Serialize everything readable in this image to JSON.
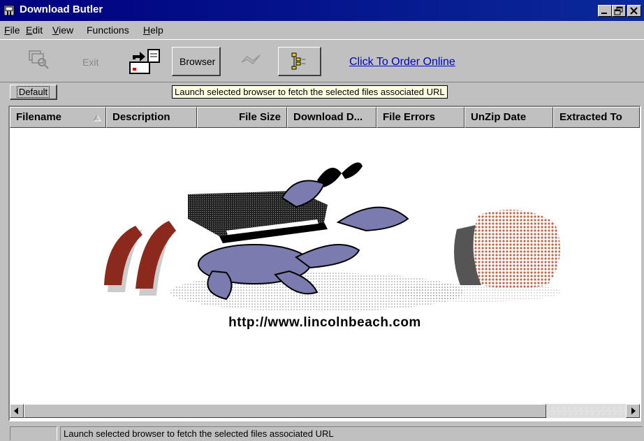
{
  "window": {
    "title": "Download Butler",
    "controls": [
      "minimize",
      "maximize",
      "close"
    ]
  },
  "menu": [
    {
      "label": "File",
      "mnemonic": "F"
    },
    {
      "label": "Edit",
      "mnemonic": "E"
    },
    {
      "label": "View",
      "mnemonic": "V"
    },
    {
      "label": "Functions",
      "mnemonic": ""
    },
    {
      "label": "Help",
      "mnemonic": "H"
    }
  ],
  "toolbar": {
    "find_icon": "search-files-icon",
    "exit_label": "Exit",
    "launch_icon": "launch-browser-icon",
    "browser_label": "Browser",
    "ok_icon": "check-icon",
    "tree_icon": "tree-view-icon",
    "order_link": "Click To Order Online"
  },
  "tab": {
    "label": "Default"
  },
  "tooltip": "Launch selected browser to fetch the selected files associated URL",
  "columns": [
    {
      "label": "Filename"
    },
    {
      "label": "Description"
    },
    {
      "label": "File Size"
    },
    {
      "label": "Download D..."
    },
    {
      "label": "File Errors"
    },
    {
      "label": "UnZip Date"
    },
    {
      "label": "Extracted To"
    }
  ],
  "banner": {
    "url": "http://www.lincolnbeach.com",
    "art": "crab-with-book-logo"
  },
  "status": {
    "pane1": "",
    "message": "Launch selected browser to fetch the selected files associated URL"
  },
  "colors": {
    "titlebar": "#000080",
    "face": "#c0c0c0",
    "link": "#0000cc",
    "tooltip_bg": "#ffffe1",
    "crab": "#7b7bb0",
    "claw": "#8b2a1c",
    "brain": "#c0694a"
  }
}
